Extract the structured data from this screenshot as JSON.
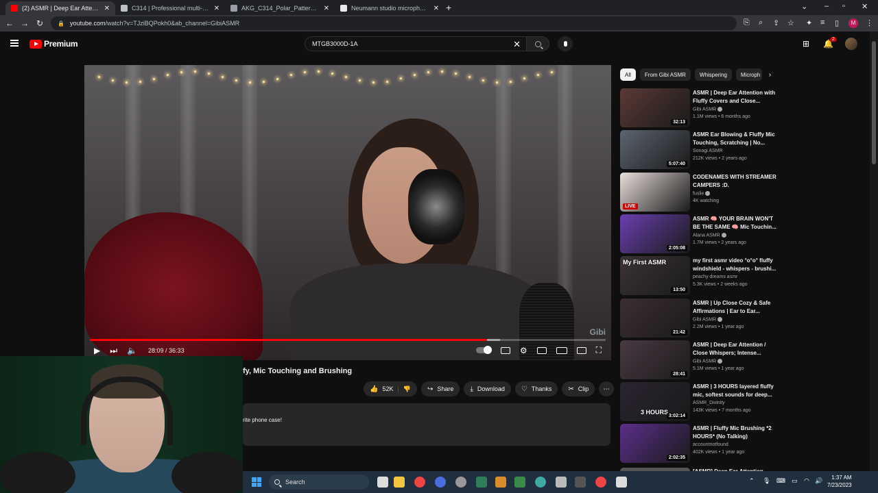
{
  "browser": {
    "tabs": [
      {
        "title": "(2) ASMR | Deep Ear Attention - Y",
        "active": true,
        "favicon_color": "#ff0000"
      },
      {
        "title": "C314 | Professional multi-pattern",
        "active": false,
        "favicon_color": "#bdc1c6"
      },
      {
        "title": "AKG_C314_Polar_Patterns.pdf",
        "active": false,
        "favicon_color": "#9aa0a6"
      },
      {
        "title": "Neumann studio microphone TLI",
        "active": false,
        "favicon_color": "#e8eaed"
      }
    ],
    "url_host": "youtube.com",
    "url_path": "/watch?v=TJziBQPokh0&ab_channel=GibiASMR",
    "profile_initial": "M"
  },
  "youtube": {
    "logo_text": "Premium",
    "search_value": "MTGB3000D-1A",
    "notification_count": "2"
  },
  "player": {
    "current_time": "28:09",
    "duration": "36:33",
    "progress_fraction": 0.77,
    "buffered_fraction": 0.795,
    "watermark": "Gibi"
  },
  "video": {
    "title_visible": "fy, Mic Touching and Brushing",
    "likes": "52K",
    "share": "Share",
    "download": "Download",
    "thanks": "Thanks",
    "clip": "Clip",
    "description_visible": "rite phone case!"
  },
  "chips": [
    "All",
    "From Gibi ASMR",
    "Whispering",
    "Microph"
  ],
  "recommendations": [
    {
      "title": "ASMR | Deep Ear Attention with Fluffy Covers and Close...",
      "channel": "Gibi ASMR",
      "verified": true,
      "meta": "1.1M views • 6 months ago",
      "duration": "32:13",
      "thumb_color": "#5a3a36"
    },
    {
      "title": "ASMR Ear Blowing & Fluffy Mic Touching, Scratching | No...",
      "channel": "Sonagi ASMR",
      "verified": false,
      "meta": "212K views • 2 years ago",
      "duration": "5:07:40",
      "thumb_color": "#5d6470"
    },
    {
      "title": "CODENAMES WITH STREAMER CAMPERS :D.",
      "channel": "fuslie",
      "verified": true,
      "meta": "4K watching",
      "live": "LIVE",
      "thumb_color": "#e8dedb"
    },
    {
      "title": "ASMR 🧠 YOUR BRAIN WON'T BE THE SAME 🧠 Mic Touchin...",
      "channel": "Alana ASMR",
      "verified": true,
      "meta": "1.7M views • 2 years ago",
      "duration": "2:05:08",
      "thumb_color": "#6a3fb0"
    },
    {
      "title": "my first asmr video °o°o° fluffy windshield - whispers - brushi...",
      "channel": "peachy dreams asmr",
      "verified": false,
      "meta": "5.3K views • 2 weeks ago",
      "duration": "13:50",
      "overlay": "My First ASMR",
      "thumb_color": "#3b3434"
    },
    {
      "title": "ASMR | Up Close Cozy & Safe Affirmations | Ear to Ear...",
      "channel": "Gibi ASMR",
      "verified": true,
      "meta": "2.2M views • 1 year ago",
      "duration": "21:42",
      "thumb_color": "#3c2e33"
    },
    {
      "title": "ASMR | Deep Ear Attention / Close Whispers; Intense...",
      "channel": "Gibi ASMR",
      "verified": true,
      "meta": "5.1M views • 1 year ago",
      "duration": "28:41",
      "thumb_color": "#4a3a44"
    },
    {
      "title": "ASMR | 3 HOURS layered fluffy mic, softest sounds for deep...",
      "channel": "ASMR_Divinity",
      "verified": false,
      "meta": "143K views • 7 months ago",
      "duration": "3:02:14",
      "overlay2": "3 HOURS",
      "thumb_color": "#2a2430"
    },
    {
      "title": "ASMR | Fluffy Mic Brushing *2 HOURS* (No Talking)",
      "channel": "accountnotfound",
      "verified": false,
      "meta": "402K views • 1 year ago",
      "duration": "2:02:35",
      "thumb_color": "#5a2f8a"
    }
  ],
  "partial_next_title": "[ASMR] Deep Ear Attention...",
  "taskbar": {
    "search_label": "Search",
    "time": "1:37 AM",
    "date": "7/23/2023"
  }
}
